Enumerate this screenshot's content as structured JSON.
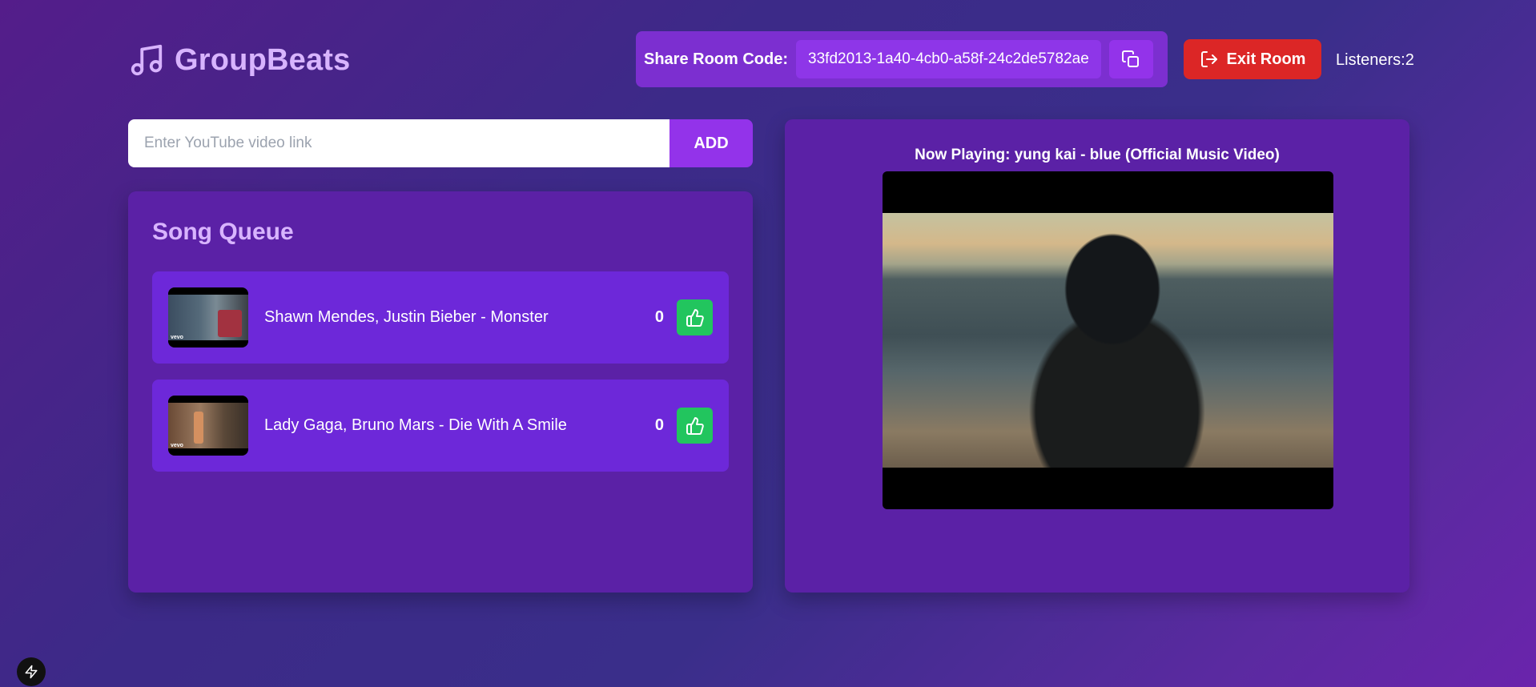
{
  "app": {
    "brand_name": "GroupBeats",
    "brand_icon": "music-note-icon",
    "brand_color": "#d8b4fe"
  },
  "header": {
    "share_label": "Share Room Code:",
    "room_code": "33fd2013-1a40-4cb0-a58f-24c2de5782ae",
    "copy_icon": "copy-icon",
    "exit_label": "Exit Room",
    "exit_icon": "logout-icon",
    "listeners_text": "Listeners:2"
  },
  "add_song": {
    "placeholder": "Enter YouTube video link",
    "value": "",
    "button_label": "ADD"
  },
  "queue": {
    "title": "Song Queue",
    "items": [
      {
        "title": "Shawn Mendes, Justin Bieber - Monster",
        "votes": "0",
        "thumb_label": "vevo",
        "upvote_icon": "thumbs-up-icon"
      },
      {
        "title": "Lady Gaga, Bruno Mars - Die With A Smile",
        "votes": "0",
        "thumb_label": "vevo",
        "upvote_icon": "thumbs-up-icon"
      }
    ]
  },
  "now_playing": {
    "title": "Now Playing: yung kai - blue (Official Music Video)"
  },
  "colors": {
    "accent": "#9333ea",
    "panel": "#5b21a6",
    "card": "#6d28d9",
    "upvote": "#22c55e",
    "exit": "#dc2626"
  }
}
